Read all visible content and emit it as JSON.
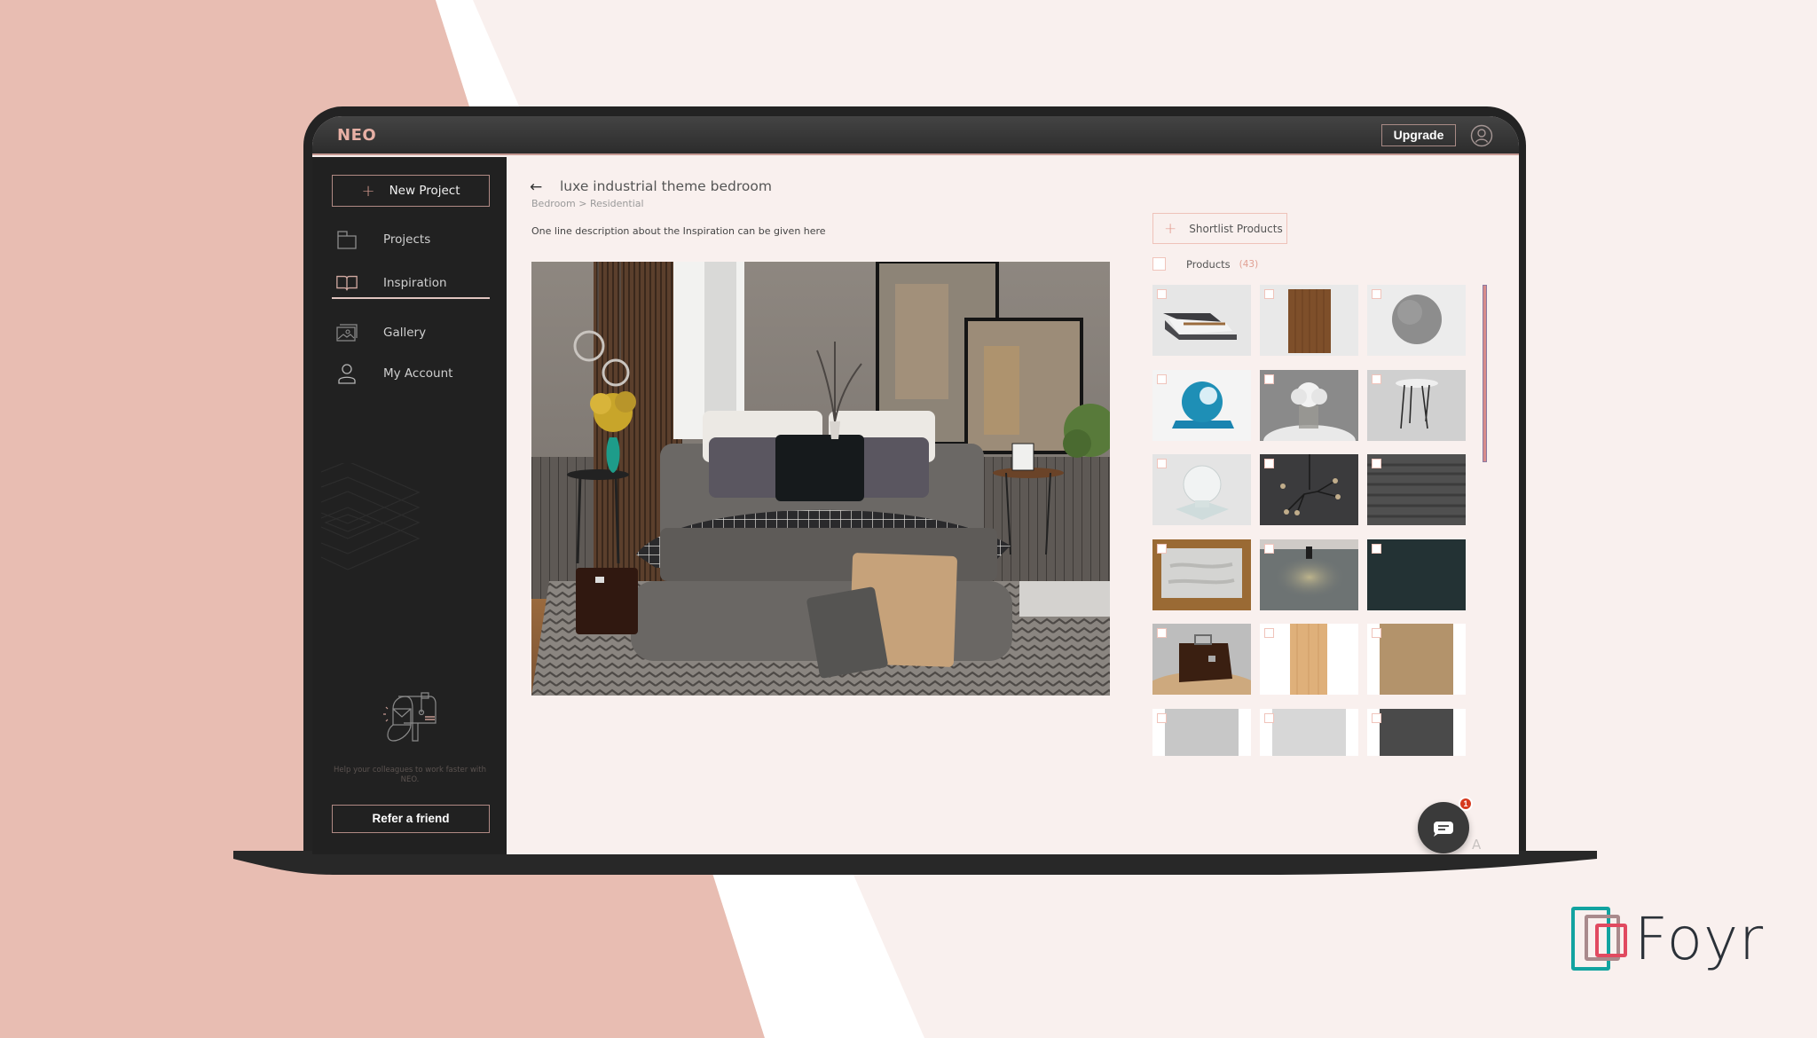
{
  "colors": {
    "background": "#f9f0ee",
    "background_pink": "#e8bdb2",
    "accent_pink": "#e19a8d",
    "dark": "#212121",
    "badge_red": "#d63a1f",
    "foyr_teal": "#12a3a0",
    "foyr_mauve": "#a98a8c",
    "foyr_red": "#e14a60"
  },
  "app": {
    "name": "NEO",
    "upgrade_label": "Upgrade",
    "user_icon": "user-circle-icon"
  },
  "sidebar": {
    "new_project_label": "New Project",
    "items": [
      {
        "label": "Projects",
        "icon": "folder-icon",
        "active": false
      },
      {
        "label": "Inspiration",
        "icon": "book-icon",
        "active": true
      },
      {
        "label": "Gallery",
        "icon": "gallery-icon",
        "active": false
      },
      {
        "label": "My Account",
        "icon": "user-icon",
        "active": false
      }
    ],
    "refer": {
      "text": "Help your colleagues to work faster with NEO.",
      "button_label": "Refer a friend"
    }
  },
  "inspiration": {
    "title": "luxe industrial theme bedroom",
    "breadcrumb": "Bedroom > Residential",
    "description": "One line description about the Inspiration can be given here",
    "shortlist_label": "Shortlist Products",
    "products_label": "Products",
    "products_count": "(43)",
    "products": [
      {
        "name": "Upholstered bed"
      },
      {
        "name": "Wood slat panel"
      },
      {
        "name": "Concrete sphere material"
      },
      {
        "name": "Blue glossy material sphere"
      },
      {
        "name": "Flower vase on table"
      },
      {
        "name": "Hairpin side table"
      },
      {
        "name": "Glass material sphere"
      },
      {
        "name": "Branch chandelier"
      },
      {
        "name": "Dark carpet texture"
      },
      {
        "name": "Rug on wood floor"
      },
      {
        "name": "Ceiling spot light"
      },
      {
        "name": "Dark teal fabric"
      },
      {
        "name": "Leather briefcase"
      },
      {
        "name": "Light wood veneer"
      },
      {
        "name": "Tan fabric"
      },
      {
        "name": "Light grey fabric"
      },
      {
        "name": "Pale grey fabric"
      },
      {
        "name": "Charcoal fabric"
      }
    ]
  },
  "chat": {
    "badge_count": "1",
    "corner_text": "A"
  },
  "brand": {
    "name": "Foyr"
  }
}
